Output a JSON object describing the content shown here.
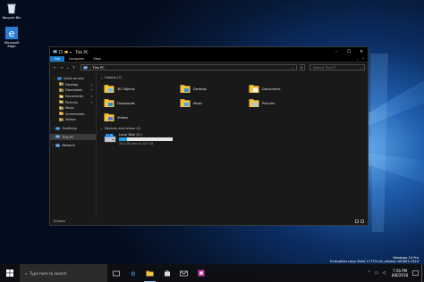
{
  "desktop": {
    "icons": [
      {
        "label": "Recycle Bin",
        "icon": "recycle-bin-icon"
      },
      {
        "label": "Microsoft Edge",
        "icon": "edge-icon"
      }
    ]
  },
  "window": {
    "title": "This PC",
    "controls": {
      "minimize": "–",
      "maximize": "☐",
      "close": "✕"
    },
    "ribbon": {
      "tabs": [
        "File",
        "Computer",
        "View"
      ],
      "expand": "⌄",
      "help": "?"
    },
    "address": {
      "back": "←",
      "forward": "→",
      "recent": "⌄",
      "up": "↑",
      "path": "This PC",
      "separator": "›",
      "dropdown": "⌄",
      "refresh": "⟳",
      "search_placeholder": "Search This PC",
      "search_icon": "⌕"
    },
    "nav": {
      "items": [
        {
          "label": "Quick access",
          "icon": "star-icon",
          "pinned": false
        },
        {
          "label": "Desktop",
          "icon": "desktop-folder-icon",
          "pinned": true
        },
        {
          "label": "Downloads",
          "icon": "downloads-folder-icon",
          "pinned": true
        },
        {
          "label": "Documents",
          "icon": "documents-folder-icon",
          "pinned": true
        },
        {
          "label": "Pictures",
          "icon": "pictures-folder-icon",
          "pinned": true
        },
        {
          "label": "Music",
          "icon": "music-folder-icon",
          "pinned": false
        },
        {
          "label": "Screenshots",
          "icon": "folder-icon",
          "pinned": false
        },
        {
          "label": "Videos",
          "icon": "videos-folder-icon",
          "pinned": false
        },
        {
          "label": "OneDrive",
          "icon": "onedrive-icon",
          "pinned": false
        },
        {
          "label": "This PC",
          "icon": "this-pc-icon",
          "pinned": false
        },
        {
          "label": "Network",
          "icon": "network-icon",
          "pinned": false
        }
      ],
      "pin_glyph": "✎"
    },
    "folders_header": "Folders (7)",
    "folders": [
      {
        "label": "3D Objects",
        "icon": "3d-objects-folder-icon"
      },
      {
        "label": "Desktop",
        "icon": "desktop-folder-icon"
      },
      {
        "label": "Documents",
        "icon": "documents-folder-icon"
      },
      {
        "label": "Downloads",
        "icon": "downloads-folder-icon"
      },
      {
        "label": "Music",
        "icon": "music-folder-icon"
      },
      {
        "label": "Pictures",
        "icon": "pictures-folder-icon"
      },
      {
        "label": "Videos",
        "icon": "videos-folder-icon"
      }
    ],
    "drives_header": "Devices and drives (1)",
    "drive": {
      "name": "Local Disk (C:)",
      "free_text": "202 GB free of 237 GB",
      "used_fraction": 0.15
    },
    "status": "8 items"
  },
  "taskbar": {
    "search_placeholder": "Type here to search",
    "search_icon": "⌕",
    "apps": [
      "task-view-icon",
      "edge-icon",
      "file-explorer-icon",
      "store-icon",
      "mail-icon",
      "settings-icon"
    ],
    "tray": {
      "chevron": "⌃",
      "network": "▭",
      "volume": "◁"
    },
    "time": "7:56 PM",
    "date": "8/8/2018"
  },
  "watermark": {
    "line1": "Windows 10 Pro",
    "line2": "Evaluation copy. Build 17733.rs5_release.180803-1524"
  },
  "colors": {
    "accent": "#1979ca",
    "folder": "#f5c542",
    "selection": "#3a3a3a",
    "drive_bar": "#26a0da"
  }
}
